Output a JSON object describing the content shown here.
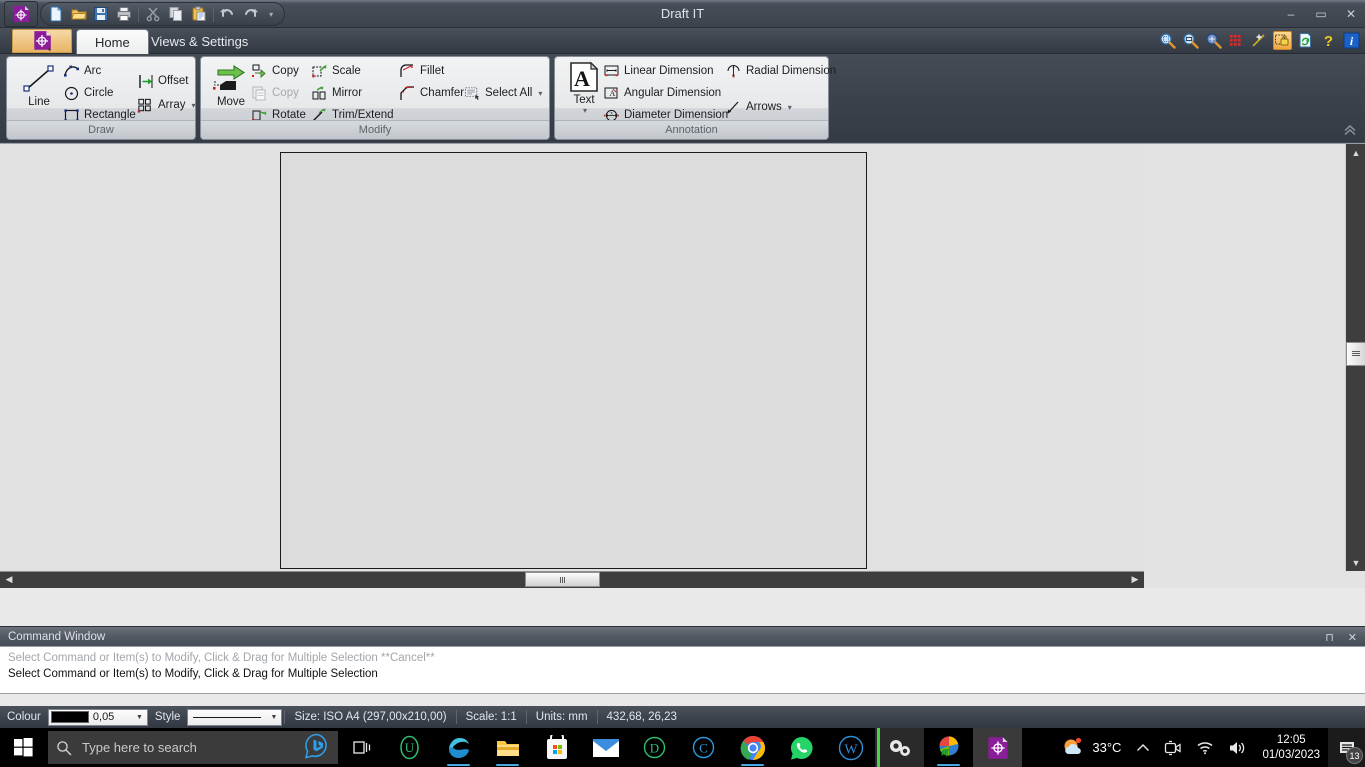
{
  "window": {
    "title": "Draft IT",
    "minimize": "–",
    "maximize": "▭",
    "close": "✕"
  },
  "quick_access": {
    "items": [
      {
        "name": "new-document",
        "label": "New"
      },
      {
        "name": "open-document",
        "label": "Open"
      },
      {
        "name": "save-document",
        "label": "Save"
      },
      {
        "name": "print-document",
        "label": "Print"
      },
      {
        "name": "cut",
        "label": "Cut"
      },
      {
        "name": "copy",
        "label": "Copy"
      },
      {
        "name": "paste",
        "label": "Paste"
      },
      {
        "name": "undo",
        "label": "Undo"
      },
      {
        "name": "redo",
        "label": "Redo"
      }
    ],
    "dropdown": "▾"
  },
  "tabs": [
    {
      "label": "Home",
      "active": true
    },
    {
      "label": "Views & Settings",
      "active": false
    }
  ],
  "tab_tools": [
    {
      "name": "zoom-extents-icon"
    },
    {
      "name": "zoom-window-icon"
    },
    {
      "name": "zoom-previous-icon"
    },
    {
      "name": "grid-icon"
    },
    {
      "name": "snap-icon"
    },
    {
      "name": "lock-icon"
    },
    {
      "name": "refresh-icon"
    },
    {
      "name": "help-icon"
    },
    {
      "name": "info-icon"
    }
  ],
  "ribbon": {
    "collapse_glyph": "⌃",
    "panels": [
      {
        "title": "Draw",
        "big": {
          "label": "Line",
          "icon": "line-icon"
        },
        "items": [
          {
            "label": "Arc",
            "icon": "arc-icon",
            "disabled": false,
            "caret": false
          },
          {
            "label": "Circle",
            "icon": "circle-icon",
            "disabled": false,
            "caret": false
          },
          {
            "label": "Rectangle",
            "icon": "rectangle-icon",
            "disabled": false,
            "caret": false
          },
          {
            "label": "Offset",
            "icon": "offset-icon",
            "disabled": false,
            "caret": false
          },
          {
            "label": "Array",
            "icon": "array-icon",
            "disabled": false,
            "caret": true
          }
        ]
      },
      {
        "title": "Modify",
        "big": {
          "label": "Move",
          "icon": "move-icon"
        },
        "items": [
          {
            "label": "Copy",
            "icon": "copy-entity-icon",
            "disabled": false,
            "caret": false
          },
          {
            "label": "Copy",
            "icon": "copy-clipboard-icon",
            "disabled": true,
            "caret": false
          },
          {
            "label": "Rotate",
            "icon": "rotate-icon",
            "disabled": false,
            "caret": false
          },
          {
            "label": "Scale",
            "icon": "scale-icon",
            "disabled": false,
            "caret": false
          },
          {
            "label": "Mirror",
            "icon": "mirror-icon",
            "disabled": false,
            "caret": false
          },
          {
            "label": "Trim/Extend",
            "icon": "trim-extend-icon",
            "disabled": false,
            "caret": false
          },
          {
            "label": "Fillet",
            "icon": "fillet-icon",
            "disabled": false,
            "caret": false
          },
          {
            "label": "Chamfer",
            "icon": "chamfer-icon",
            "disabled": false,
            "caret": false
          },
          {
            "label": "Select All",
            "icon": "select-all-icon",
            "disabled": false,
            "caret": true
          }
        ]
      },
      {
        "title": "Annotation",
        "big": {
          "label": "Text",
          "icon": "text-icon",
          "caret": "▾"
        },
        "items": [
          {
            "label": "Linear Dimension",
            "icon": "linear-dimension-icon",
            "disabled": false,
            "caret": false
          },
          {
            "label": "Angular Dimension",
            "icon": "angular-dimension-icon",
            "disabled": false,
            "caret": false
          },
          {
            "label": "Diameter Dimension",
            "icon": "diameter-dimension-icon",
            "disabled": false,
            "caret": false
          },
          {
            "label": "Radial Dimension",
            "icon": "radial-dimension-icon",
            "disabled": false,
            "caret": false
          },
          {
            "label": "Arrows",
            "icon": "arrows-icon",
            "disabled": false,
            "caret": true
          }
        ]
      }
    ]
  },
  "command_window": {
    "title": "Command Window",
    "pin_glyph": "⊓",
    "close_glyph": "✕",
    "previous_line": "Select Command or Item(s) to Modify, Click & Drag for Multiple Selection  **Cancel**",
    "current_line": "Select Command or Item(s) to Modify, Click & Drag for Multiple Selection"
  },
  "status_bar": {
    "colour_label": "Colour",
    "colour_swatch": "#000000",
    "line_weight": "0,05",
    "style_label": "Style",
    "size": "Size: ISO A4 (297,00x210,00)",
    "scale": "Scale: 1:1",
    "units": "Units: mm",
    "coordinates": "432,68, 26,23"
  },
  "taskbar": {
    "search_placeholder": "Type here to search",
    "apps": [
      {
        "name": "taskbar-app-start-u",
        "glyph": "U",
        "color": "#2fbf71"
      },
      {
        "name": "taskbar-app-edge",
        "glyph": "",
        "color": "#2d8fd5"
      },
      {
        "name": "taskbar-app-file-explorer",
        "glyph": "",
        "color": "#ffc83d"
      },
      {
        "name": "taskbar-app-microsoft-store",
        "glyph": "",
        "color": "#f0f0f0"
      },
      {
        "name": "taskbar-app-mail",
        "glyph": "",
        "color": "#2f7fd1"
      },
      {
        "name": "taskbar-app-d",
        "glyph": "D",
        "color": "#2fbf71"
      },
      {
        "name": "taskbar-app-c",
        "glyph": "C",
        "color": "#2d9bdc"
      },
      {
        "name": "taskbar-app-chrome",
        "glyph": "",
        "color": "#e8453c"
      },
      {
        "name": "taskbar-app-whatsapp",
        "glyph": "",
        "color": "#25d366"
      },
      {
        "name": "taskbar-app-wordpress",
        "glyph": "W",
        "color": "#2d8fd5"
      },
      {
        "name": "taskbar-app-gears",
        "glyph": "",
        "color": "#e8e8e8"
      },
      {
        "name": "taskbar-app-idm",
        "glyph": "",
        "color": "#2fbf71"
      },
      {
        "name": "taskbar-app-draft-it",
        "glyph": "",
        "color": "#8b1d9b"
      }
    ],
    "tray": {
      "weather_temp": "33°C",
      "chevron": "⌃",
      "time": "12:05",
      "date": "01/03/2023",
      "notification_count": "13"
    }
  }
}
